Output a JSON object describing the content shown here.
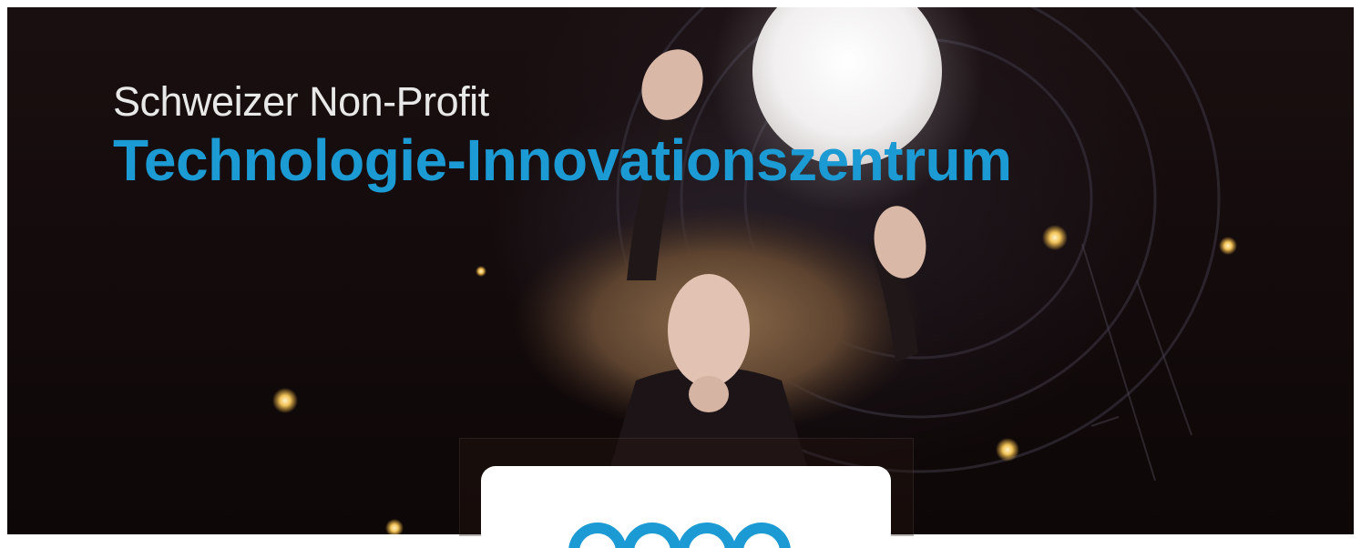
{
  "hero": {
    "kicker": "Schweizer Non-Profit",
    "title": "Technologie-Innovationszentrum",
    "colors": {
      "title": "#1b9ad3",
      "kicker": "#e8e8e8",
      "background": "#120a0b"
    }
  },
  "card": {
    "logo_icon": "brand-logo-icon",
    "logo_color": "#1b9ad3"
  }
}
